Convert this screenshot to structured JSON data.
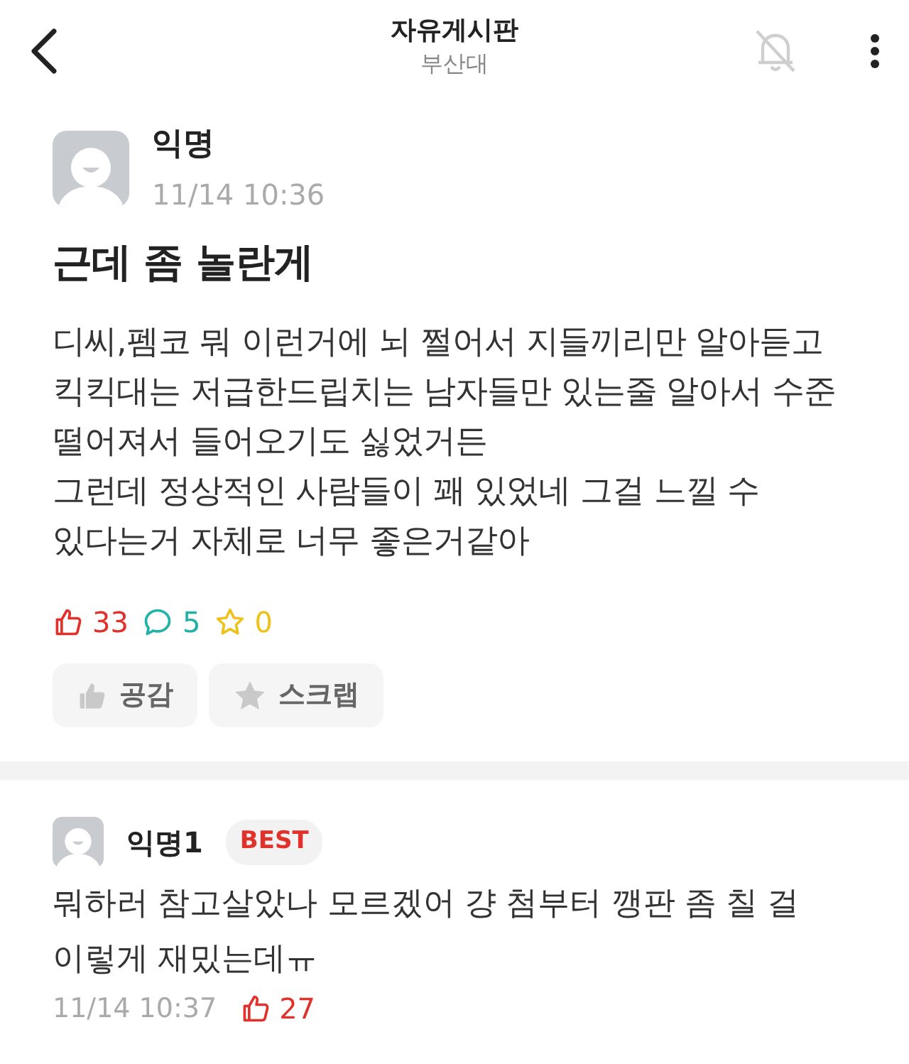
{
  "header": {
    "title": "자유게시판",
    "subtitle": "부산대",
    "notifications_on": false
  },
  "post": {
    "author": "익명",
    "time": "11/14 10:36",
    "title": "근데 좀 놀란게",
    "paragraphs": [
      "디씨,펨코 뭐 이런거에 뇌 쩔어서 지들끼리만 알아듣고 킥킥대는 저급한드립치는 남자들만 있는줄 알아서 수준 떨어져서 들어오기도 싫었거든",
      "그런데 정상적인 사람들이 꽤 있었네 그걸 느낄 수 있다는거 자체로 너무 좋은거같아"
    ],
    "stats": [
      {
        "kind": "like",
        "count": "33"
      },
      {
        "kind": "comment",
        "count": "5"
      },
      {
        "kind": "scrap",
        "count": "0"
      }
    ],
    "actions": [
      {
        "kind": "like",
        "label": "공감"
      },
      {
        "kind": "scrap",
        "label": "스크랩"
      }
    ]
  },
  "comments": [
    {
      "author": "익명1",
      "badge": "BEST",
      "text": "뭐하러 참고살았나 모르겠어 걍 첨부터 깽판 좀 칠 걸 이렇게 재밌는데ㅠ",
      "time": "11/14 10:37",
      "likes": "27"
    }
  ]
}
